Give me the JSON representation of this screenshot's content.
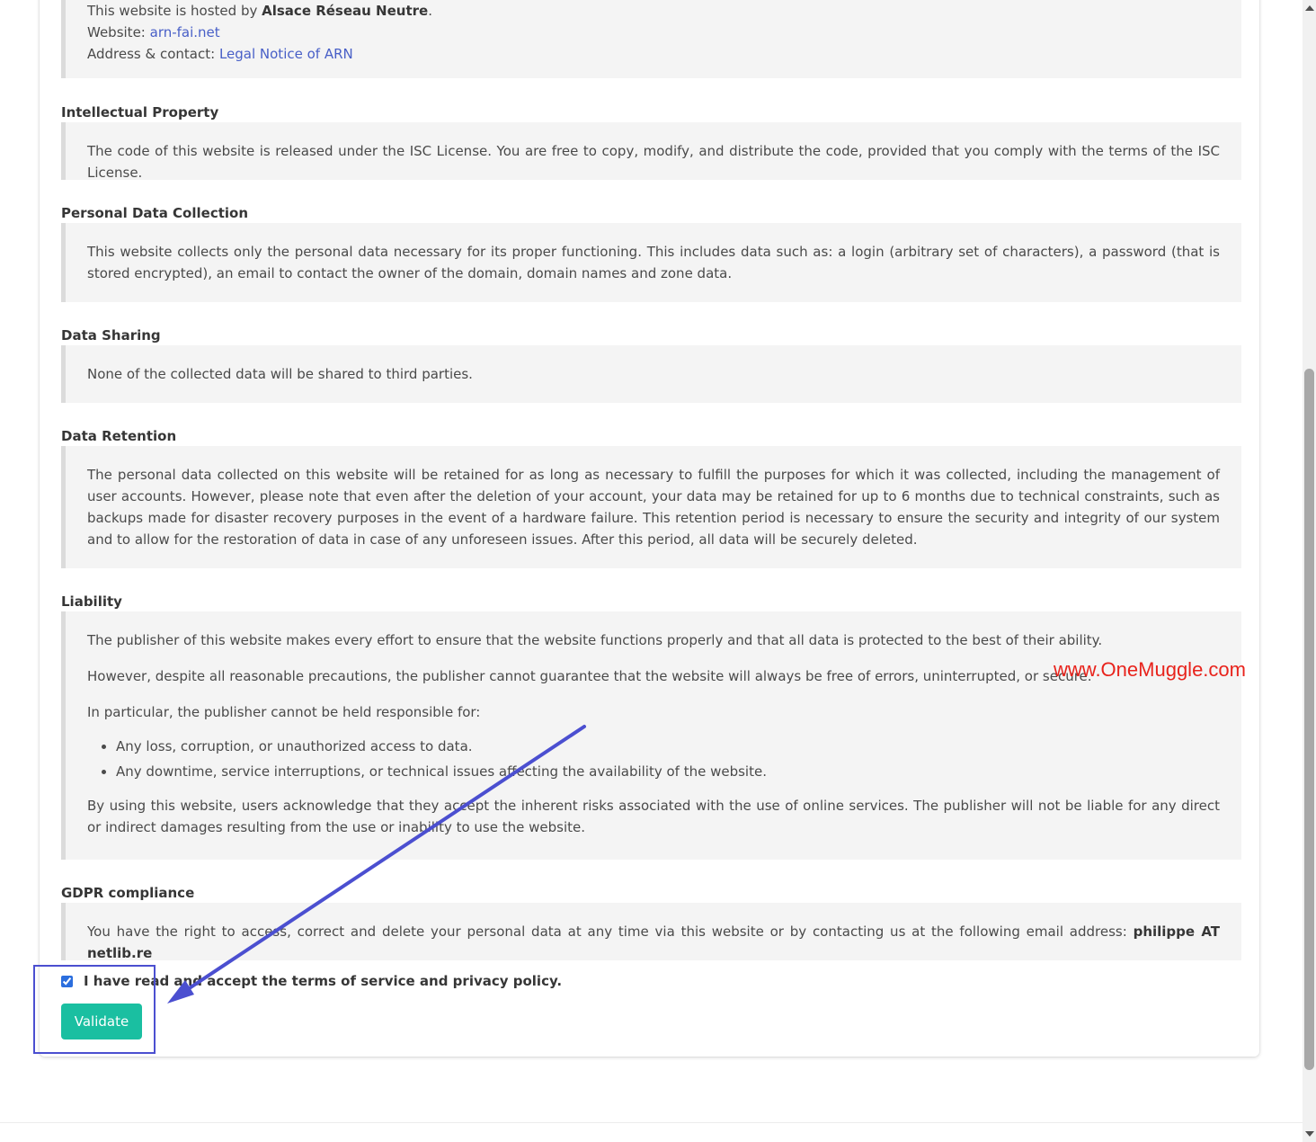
{
  "hosting": {
    "line1_prefix": "This website is hosted by ",
    "line1_bold": "Alsace Réseau Neutre",
    "line1_suffix": ".",
    "website_label": "Website: ",
    "website_link": "arn-fai.net",
    "address_label": "Address & contact: ",
    "address_link": "Legal Notice of ARN"
  },
  "sections": {
    "ip": {
      "heading": "Intellectual Property",
      "text": "The code of this website is released under the ISC License. You are free to copy, modify, and distribute the code, provided that you comply with the terms of the ISC License."
    },
    "personal_data": {
      "heading": "Personal Data Collection",
      "text": "This website collects only the personal data necessary for its proper functioning. This includes data such as: a login (arbitrary set of characters), a password (that is stored encrypted), an email to contact the owner of the domain, domain names and zone data."
    },
    "sharing": {
      "heading": "Data Sharing",
      "text": "None of the collected data will be shared to third parties."
    },
    "retention": {
      "heading": "Data Retention",
      "text": "The personal data collected on this website will be retained for as long as necessary to fulfill the purposes for which it was collected, including the management of user accounts. However, please note that even after the deletion of your account, your data may be retained for up to 6 months due to technical constraints, such as backups made for disaster recovery purposes in the event of a hardware failure. This retention period is necessary to ensure the security and integrity of our system and to allow for the restoration of data in case of any unforeseen issues. After this period, all data will be securely deleted."
    },
    "liability": {
      "heading": "Liability",
      "p1": "The publisher of this website makes every effort to ensure that the website functions properly and that all data is protected to the best of their ability.",
      "p2": "However, despite all reasonable precautions, the publisher cannot guarantee that the website will always be free of errors, uninterrupted, or secure.",
      "p3": "In particular, the publisher cannot be held responsible for:",
      "bullets": [
        "Any loss, corruption, or unauthorized access to data.",
        "Any downtime, service interruptions, or technical issues affecting the availability of the website."
      ],
      "p4": "By using this website, users acknowledge that they accept the inherent risks associated with the use of online services. The publisher will not be liable for any direct or indirect damages resulting from the use or inability to use the website."
    },
    "gdpr": {
      "heading": "GDPR compliance",
      "text_prefix": "You have the right to access, correct and delete your personal data at any time via this website or by contacting us at the following email address: ",
      "email": "philippe AT netlib.re"
    }
  },
  "form": {
    "checkbox_label": "I have read and accept the terms of service and privacy policy.",
    "checkbox_checked": true,
    "validate_label": "Validate"
  },
  "watermark": "www.OneMuggle.com",
  "colors": {
    "accent": "#1abfa1",
    "link": "#485fc7",
    "annotation": "#4b4fd0",
    "watermark": "#e8231c"
  }
}
